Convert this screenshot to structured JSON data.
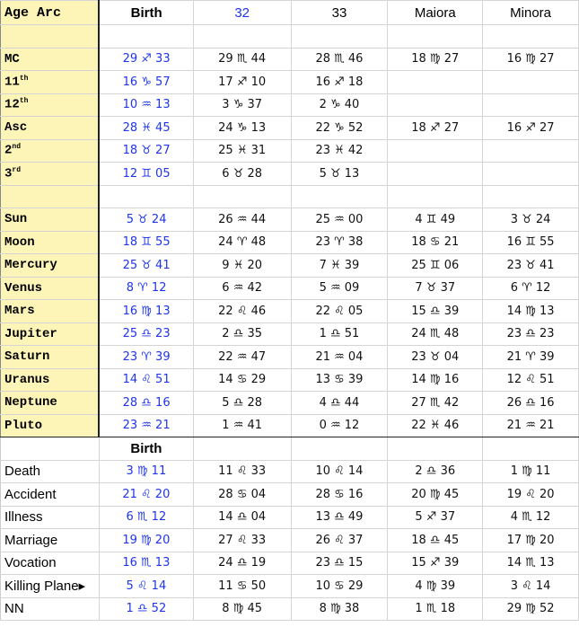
{
  "header": {
    "col0": "Age Arc",
    "col1": "Birth",
    "col2": "32",
    "col3": "33",
    "col4": "Maiora",
    "col5": "Minora"
  },
  "section2_header": "Birth",
  "rows_top": [
    {
      "label": "",
      "cells": [
        "",
        "",
        "",
        "",
        ""
      ]
    },
    {
      "label": "MC",
      "cells": [
        "29 ♐ 33",
        "29 ♏ 44",
        "28 ♏ 46",
        "18 ♍ 27",
        "16 ♍ 27"
      ]
    },
    {
      "label": "11th",
      "cells": [
        "16 ♑ 57",
        "17 ♐ 10",
        "16 ♐ 18",
        "",
        ""
      ]
    },
    {
      "label": "12th",
      "cells": [
        "10 ♒ 13",
        "3 ♑ 37",
        "2 ♑ 40",
        "",
        ""
      ]
    },
    {
      "label": "Asc",
      "cells": [
        "28 ♓ 45",
        "24 ♑ 13",
        "22 ♑ 52",
        "18 ♐ 27",
        "16 ♐ 27"
      ]
    },
    {
      "label": "2nd",
      "cells": [
        "18 ♉ 27",
        "25 ♓ 31",
        "23 ♓ 42",
        "",
        ""
      ]
    },
    {
      "label": "3rd",
      "cells": [
        "12 ♊ 05",
        "6 ♉ 28",
        "5 ♉ 13",
        "",
        ""
      ]
    },
    {
      "label": "",
      "cells": [
        "",
        "",
        "",
        "",
        ""
      ]
    },
    {
      "label": "Sun",
      "cells": [
        "5 ♉ 24",
        "26 ♒ 44",
        "25 ♒ 00",
        "4 ♊ 49",
        "3 ♉ 24"
      ]
    },
    {
      "label": "Moon",
      "cells": [
        "18 ♊ 55",
        "24 ♈ 48",
        "23 ♈ 38",
        "18 ♋ 21",
        "16 ♊ 55"
      ]
    },
    {
      "label": "Mercury",
      "cells": [
        "25 ♉ 41",
        "9 ♓ 20",
        "7 ♓ 39",
        "25 ♊ 06",
        "23 ♉ 41"
      ]
    },
    {
      "label": "Venus",
      "cells": [
        "8 ♈ 12",
        "6 ♒ 42",
        "5 ♒ 09",
        "7 ♉ 37",
        "6 ♈ 12"
      ]
    },
    {
      "label": "Mars",
      "cells": [
        "16 ♍ 13",
        "22 ♌ 46",
        "22 ♌ 05",
        "15 ♎ 39",
        "14 ♍ 13"
      ]
    },
    {
      "label": "Jupiter",
      "cells": [
        "25 ♎ 23",
        "2 ♎ 35",
        "1 ♎ 51",
        "24 ♏ 48",
        "23 ♎ 23"
      ]
    },
    {
      "label": "Saturn",
      "cells": [
        "23 ♈ 39",
        "22 ♒ 47",
        "21 ♒ 04",
        "23 ♉ 04",
        "21 ♈ 39"
      ]
    },
    {
      "label": "Uranus",
      "cells": [
        "14 ♌ 51",
        "14 ♋ 29",
        "13 ♋ 39",
        "14 ♍ 16",
        "12 ♌ 51"
      ]
    },
    {
      "label": "Neptune",
      "cells": [
        "28 ♎ 16",
        "5 ♎ 28",
        "4 ♎ 44",
        "27 ♏ 42",
        "26 ♎ 16"
      ]
    },
    {
      "label": "Pluto",
      "cells": [
        "23 ♒ 21",
        "1 ♒ 41",
        "0 ♒ 12",
        "22 ♓ 46",
        "21 ♒ 21"
      ]
    }
  ],
  "rows_bottom": [
    {
      "label": "Death",
      "cells": [
        "3 ♍ 11",
        "11 ♌ 33",
        "10 ♌ 14",
        "2 ♎ 36",
        "1 ♍ 11"
      ]
    },
    {
      "label": "Accident",
      "cells": [
        "21 ♌ 20",
        "28 ♋ 04",
        "28 ♋ 16",
        "20 ♍ 45",
        "19 ♌ 20"
      ]
    },
    {
      "label": "Illness",
      "cells": [
        "6 ♏ 12",
        "14 ♎ 04",
        "13 ♎ 49",
        "5 ♐ 37",
        "4 ♏ 12"
      ]
    },
    {
      "label": "Marriage",
      "cells": [
        "19 ♍ 20",
        "27 ♌ 33",
        "26 ♌ 37",
        "18 ♎ 45",
        "17 ♍ 20"
      ]
    },
    {
      "label": "Vocation",
      "cells": [
        "16 ♏ 13",
        "24 ♎ 19",
        "23 ♎ 15",
        "15 ♐ 39",
        "14 ♏ 13"
      ]
    },
    {
      "label": "Killing Plane▸",
      "cells": [
        "5 ♌ 14",
        "11 ♋ 50",
        "10 ♋ 29",
        "4 ♍ 39",
        "3 ♌ 14"
      ]
    },
    {
      "label": "NN",
      "cells": [
        "1 ♎ 52",
        "8 ♍ 45",
        "8 ♍ 38",
        "1 ♏ 18",
        "29 ♍ 52"
      ]
    }
  ]
}
